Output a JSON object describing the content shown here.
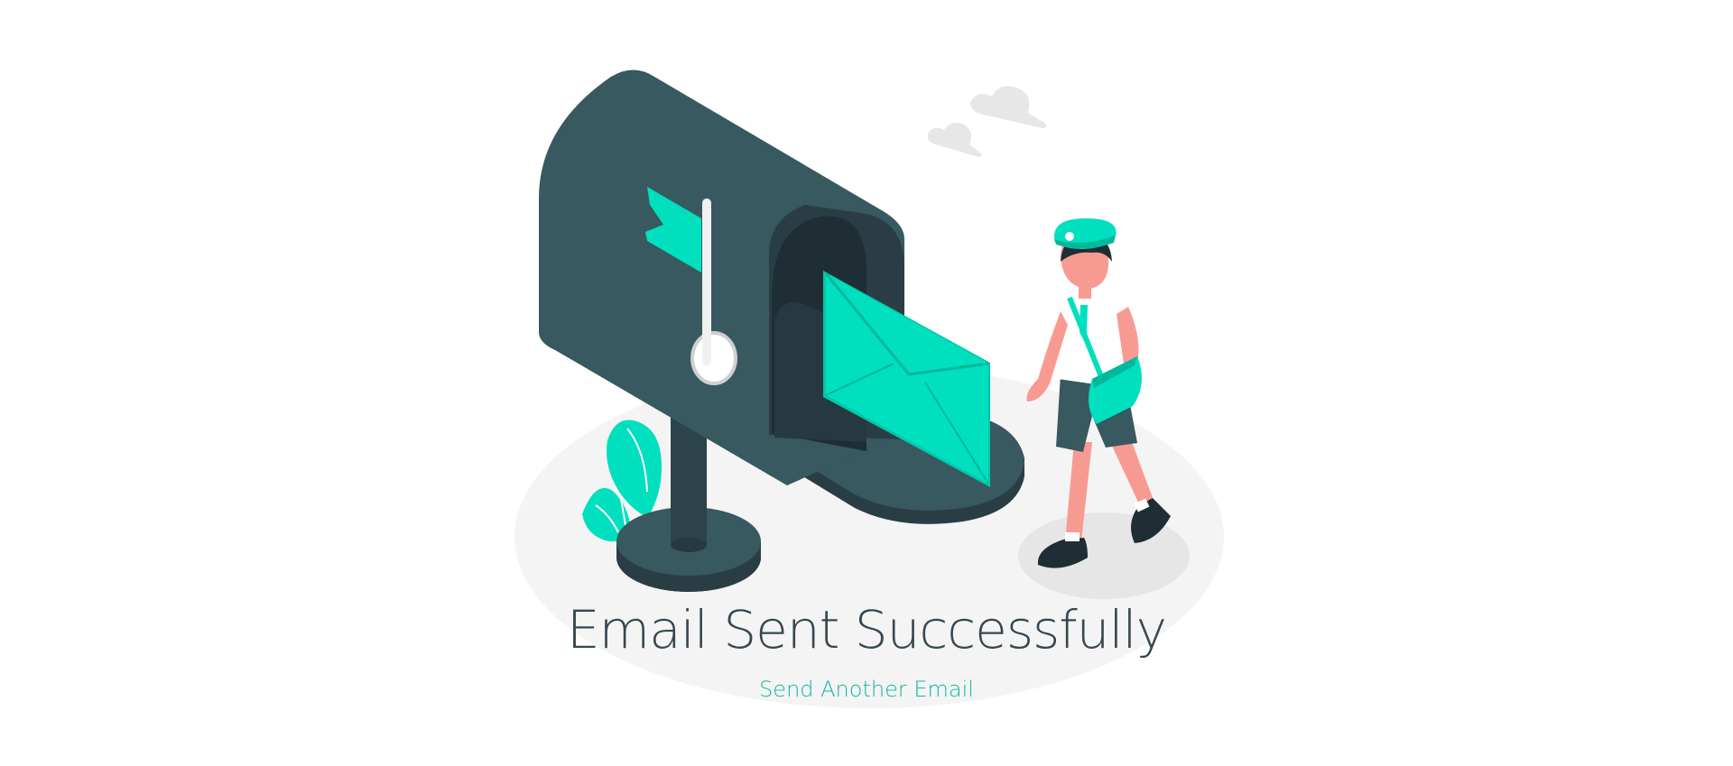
{
  "confirmation": {
    "title": "Email Sent Successfully",
    "action_label": "Send Another Email"
  },
  "colors": {
    "accent": "#00dfbe",
    "dark": "#37474f",
    "ground": "#f3f3f3",
    "link": "#12b8a0"
  },
  "illustration": {
    "icons": [
      "mailbox-icon",
      "envelope-icon",
      "flag-icon",
      "plant-icon",
      "cloud-icon",
      "mail-carrier-icon"
    ]
  }
}
